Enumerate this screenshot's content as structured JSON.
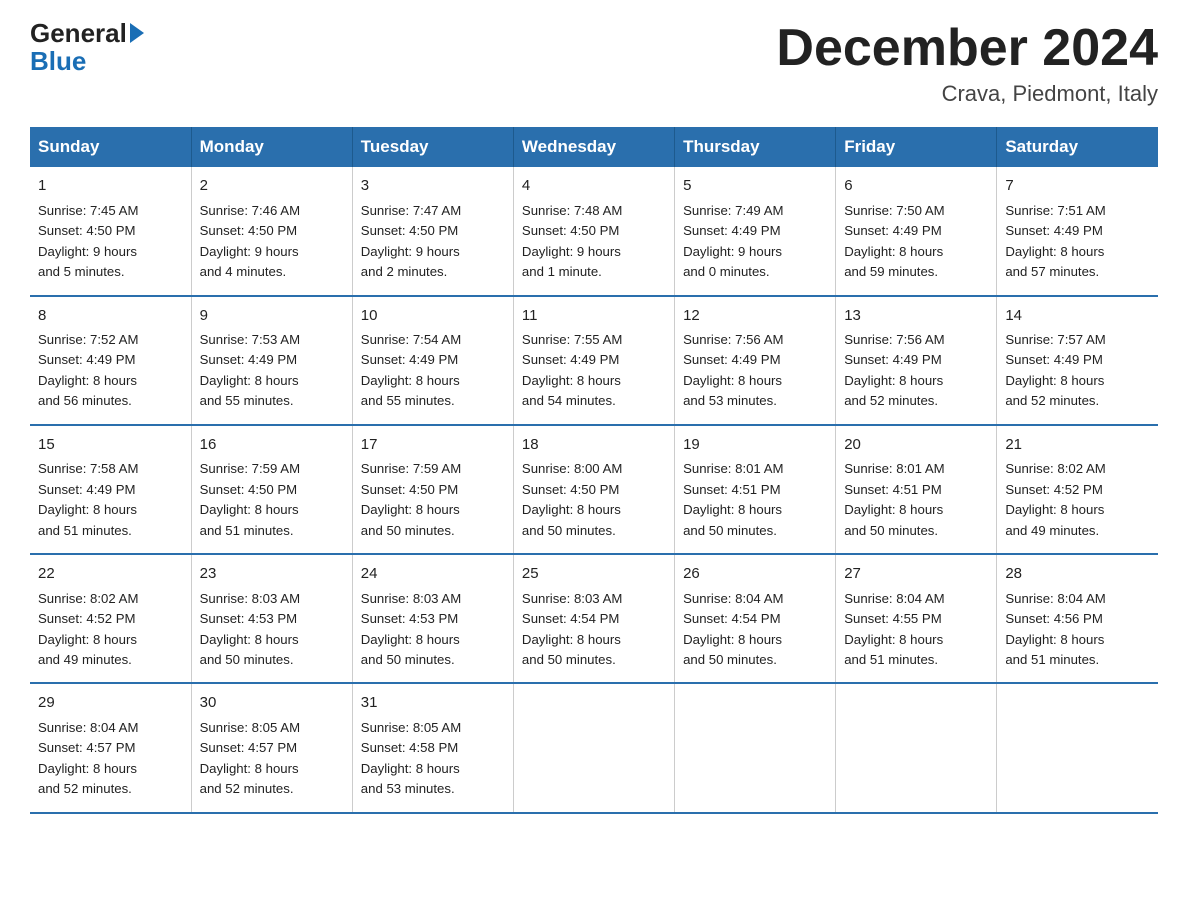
{
  "header": {
    "logo_general": "General",
    "logo_blue": "Blue",
    "title": "December 2024",
    "location": "Crava, Piedmont, Italy"
  },
  "weekdays": [
    "Sunday",
    "Monday",
    "Tuesday",
    "Wednesday",
    "Thursday",
    "Friday",
    "Saturday"
  ],
  "weeks": [
    [
      {
        "day": "1",
        "sunrise": "7:45 AM",
        "sunset": "4:50 PM",
        "daylight": "9 hours and 5 minutes."
      },
      {
        "day": "2",
        "sunrise": "7:46 AM",
        "sunset": "4:50 PM",
        "daylight": "9 hours and 4 minutes."
      },
      {
        "day": "3",
        "sunrise": "7:47 AM",
        "sunset": "4:50 PM",
        "daylight": "9 hours and 2 minutes."
      },
      {
        "day": "4",
        "sunrise": "7:48 AM",
        "sunset": "4:50 PM",
        "daylight": "9 hours and 1 minute."
      },
      {
        "day": "5",
        "sunrise": "7:49 AM",
        "sunset": "4:49 PM",
        "daylight": "9 hours and 0 minutes."
      },
      {
        "day": "6",
        "sunrise": "7:50 AM",
        "sunset": "4:49 PM",
        "daylight": "8 hours and 59 minutes."
      },
      {
        "day": "7",
        "sunrise": "7:51 AM",
        "sunset": "4:49 PM",
        "daylight": "8 hours and 57 minutes."
      }
    ],
    [
      {
        "day": "8",
        "sunrise": "7:52 AM",
        "sunset": "4:49 PM",
        "daylight": "8 hours and 56 minutes."
      },
      {
        "day": "9",
        "sunrise": "7:53 AM",
        "sunset": "4:49 PM",
        "daylight": "8 hours and 55 minutes."
      },
      {
        "day": "10",
        "sunrise": "7:54 AM",
        "sunset": "4:49 PM",
        "daylight": "8 hours and 55 minutes."
      },
      {
        "day": "11",
        "sunrise": "7:55 AM",
        "sunset": "4:49 PM",
        "daylight": "8 hours and 54 minutes."
      },
      {
        "day": "12",
        "sunrise": "7:56 AM",
        "sunset": "4:49 PM",
        "daylight": "8 hours and 53 minutes."
      },
      {
        "day": "13",
        "sunrise": "7:56 AM",
        "sunset": "4:49 PM",
        "daylight": "8 hours and 52 minutes."
      },
      {
        "day": "14",
        "sunrise": "7:57 AM",
        "sunset": "4:49 PM",
        "daylight": "8 hours and 52 minutes."
      }
    ],
    [
      {
        "day": "15",
        "sunrise": "7:58 AM",
        "sunset": "4:49 PM",
        "daylight": "8 hours and 51 minutes."
      },
      {
        "day": "16",
        "sunrise": "7:59 AM",
        "sunset": "4:50 PM",
        "daylight": "8 hours and 51 minutes."
      },
      {
        "day": "17",
        "sunrise": "7:59 AM",
        "sunset": "4:50 PM",
        "daylight": "8 hours and 50 minutes."
      },
      {
        "day": "18",
        "sunrise": "8:00 AM",
        "sunset": "4:50 PM",
        "daylight": "8 hours and 50 minutes."
      },
      {
        "day": "19",
        "sunrise": "8:01 AM",
        "sunset": "4:51 PM",
        "daylight": "8 hours and 50 minutes."
      },
      {
        "day": "20",
        "sunrise": "8:01 AM",
        "sunset": "4:51 PM",
        "daylight": "8 hours and 50 minutes."
      },
      {
        "day": "21",
        "sunrise": "8:02 AM",
        "sunset": "4:52 PM",
        "daylight": "8 hours and 49 minutes."
      }
    ],
    [
      {
        "day": "22",
        "sunrise": "8:02 AM",
        "sunset": "4:52 PM",
        "daylight": "8 hours and 49 minutes."
      },
      {
        "day": "23",
        "sunrise": "8:03 AM",
        "sunset": "4:53 PM",
        "daylight": "8 hours and 50 minutes."
      },
      {
        "day": "24",
        "sunrise": "8:03 AM",
        "sunset": "4:53 PM",
        "daylight": "8 hours and 50 minutes."
      },
      {
        "day": "25",
        "sunrise": "8:03 AM",
        "sunset": "4:54 PM",
        "daylight": "8 hours and 50 minutes."
      },
      {
        "day": "26",
        "sunrise": "8:04 AM",
        "sunset": "4:54 PM",
        "daylight": "8 hours and 50 minutes."
      },
      {
        "day": "27",
        "sunrise": "8:04 AM",
        "sunset": "4:55 PM",
        "daylight": "8 hours and 51 minutes."
      },
      {
        "day": "28",
        "sunrise": "8:04 AM",
        "sunset": "4:56 PM",
        "daylight": "8 hours and 51 minutes."
      }
    ],
    [
      {
        "day": "29",
        "sunrise": "8:04 AM",
        "sunset": "4:57 PM",
        "daylight": "8 hours and 52 minutes."
      },
      {
        "day": "30",
        "sunrise": "8:05 AM",
        "sunset": "4:57 PM",
        "daylight": "8 hours and 52 minutes."
      },
      {
        "day": "31",
        "sunrise": "8:05 AM",
        "sunset": "4:58 PM",
        "daylight": "8 hours and 53 minutes."
      },
      null,
      null,
      null,
      null
    ]
  ],
  "labels": {
    "sunrise": "Sunrise:",
    "sunset": "Sunset:",
    "daylight": "Daylight:"
  }
}
